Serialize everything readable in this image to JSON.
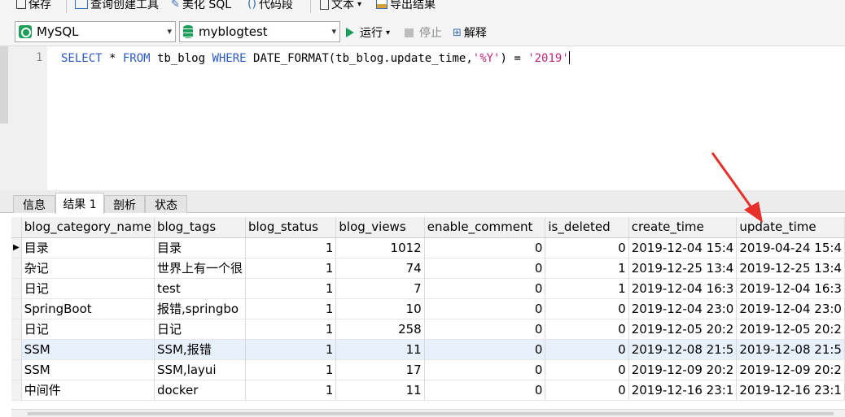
{
  "toolbar": {
    "save": "保存",
    "query_builder": "查询创建工具",
    "beautify": "美化 SQL",
    "snippet": "代码段",
    "text": "文本",
    "text_caret": "▾",
    "export": "导出结果"
  },
  "connection": {
    "value": "MySQL",
    "caret": "▾"
  },
  "database": {
    "value": "myblogtest",
    "caret": "▾"
  },
  "actions": {
    "run": "运行",
    "run_caret": "▾",
    "stop": "停止",
    "explain": "解释"
  },
  "editor": {
    "line_number": "1",
    "tokens": {
      "t1": "SELECT",
      "t2": " * ",
      "t3": "FROM",
      "t4": " tb_blog ",
      "t5": "WHERE",
      "t6": " DATE_FORMAT(tb_blog.update_time,",
      "t7": "'%Y'",
      "t8": ") = ",
      "t9": "'2019'"
    }
  },
  "result_tabs": [
    {
      "label": "信息"
    },
    {
      "label": "结果 1"
    },
    {
      "label": "剖析"
    },
    {
      "label": "状态"
    }
  ],
  "grid": {
    "columns": [
      "blog_category_name",
      "blog_tags",
      "blog_status",
      "blog_views",
      "enable_comment",
      "is_deleted",
      "create_time",
      "update_time"
    ],
    "current_row_marker": "▶",
    "rows": [
      [
        "目录",
        "目录",
        "1",
        "1012",
        "0",
        "0",
        "2019-12-04 15:4",
        "2019-04-24 15:4"
      ],
      [
        "杂记",
        "世界上有一个很",
        "1",
        "74",
        "0",
        "1",
        "2019-12-25 13:4",
        "2019-12-25 13:4"
      ],
      [
        "日记",
        "test",
        "1",
        "7",
        "0",
        "1",
        "2019-12-04 16:3",
        "2019-12-04 16:3"
      ],
      [
        "SpringBoot",
        "报错,springbo",
        "1",
        "10",
        "0",
        "0",
        "2019-12-04 23:0",
        "2019-12-04 23:0"
      ],
      [
        "日记",
        "日记",
        "1",
        "258",
        "0",
        "0",
        "2019-12-05 20:2",
        "2019-12-05 20:2"
      ],
      [
        "SSM",
        "SSM,报错",
        "1",
        "11",
        "0",
        "0",
        "2019-12-08 21:5",
        "2019-12-08 21:5"
      ],
      [
        "SSM",
        "SSM,layui",
        "1",
        "17",
        "0",
        "0",
        "2019-12-09 20:2",
        "2019-12-09 20:2"
      ],
      [
        "中间件",
        "docker",
        "1",
        "11",
        "0",
        "0",
        "2019-12-16 23:1",
        "2019-12-16 23:1"
      ]
    ]
  },
  "colors": {
    "keyword": "#2a59c0",
    "string": "#c0287a",
    "accent_green": "#1aa05a",
    "annotation_arrow": "#e8302a"
  }
}
